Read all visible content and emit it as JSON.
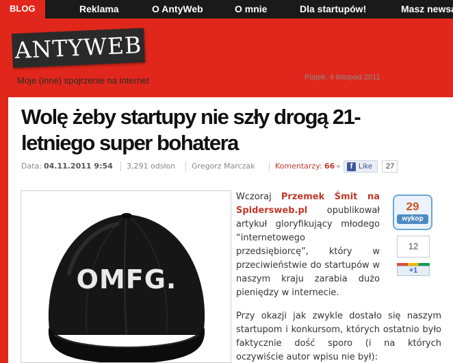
{
  "nav": {
    "items": [
      "BLOG",
      "Reklama",
      "O AntyWeb",
      "O mnie",
      "Dla startupów!",
      "Masz newsa"
    ]
  },
  "header": {
    "logo": "ANTYWEB",
    "tagline": "Moje (inne) spojrzenie na internet",
    "date": "Piątek, 4 listopad 2011"
  },
  "article": {
    "title": "Wolę żeby startupy nie szły drogą 21-letniego super bohatera",
    "meta": {
      "date_label": "Data:",
      "date_value": "04.11.2011 9:54",
      "views": "3,291 odsłon",
      "author": "Gregorz Marczak",
      "comments_label": "Komentarzy:",
      "comments_count": "66",
      "comments_arrow": "»"
    },
    "image_text": "OMFG.",
    "para1_before": "Wczoraj ",
    "para1_link": "Przemek Śmit na Spidersweb.pl",
    "para1_after": " opublikował artykuł gloryfikujący młodego “internetowego przedsiębiorcę”, który w przeciwieństwie do startupów w naszym kraju zarabia dużo pieniędzy w internecie.",
    "para2": "Przy okazji jak zwykle dostało się naszym startupom i konkursom, których ostatnio było faktycznie dość sporo (i na których oczywiście autor wpisu nie był):"
  },
  "social": {
    "like_label": "Like",
    "like_count": "27",
    "wykop_count": "29",
    "wykop_label": "wykop",
    "gplus_count": "12",
    "gplus_label": "+1"
  },
  "colors": {
    "brand_red": "#e1271b",
    "nav_bg": "#1a1a1a",
    "link_red": "#c0392b"
  }
}
